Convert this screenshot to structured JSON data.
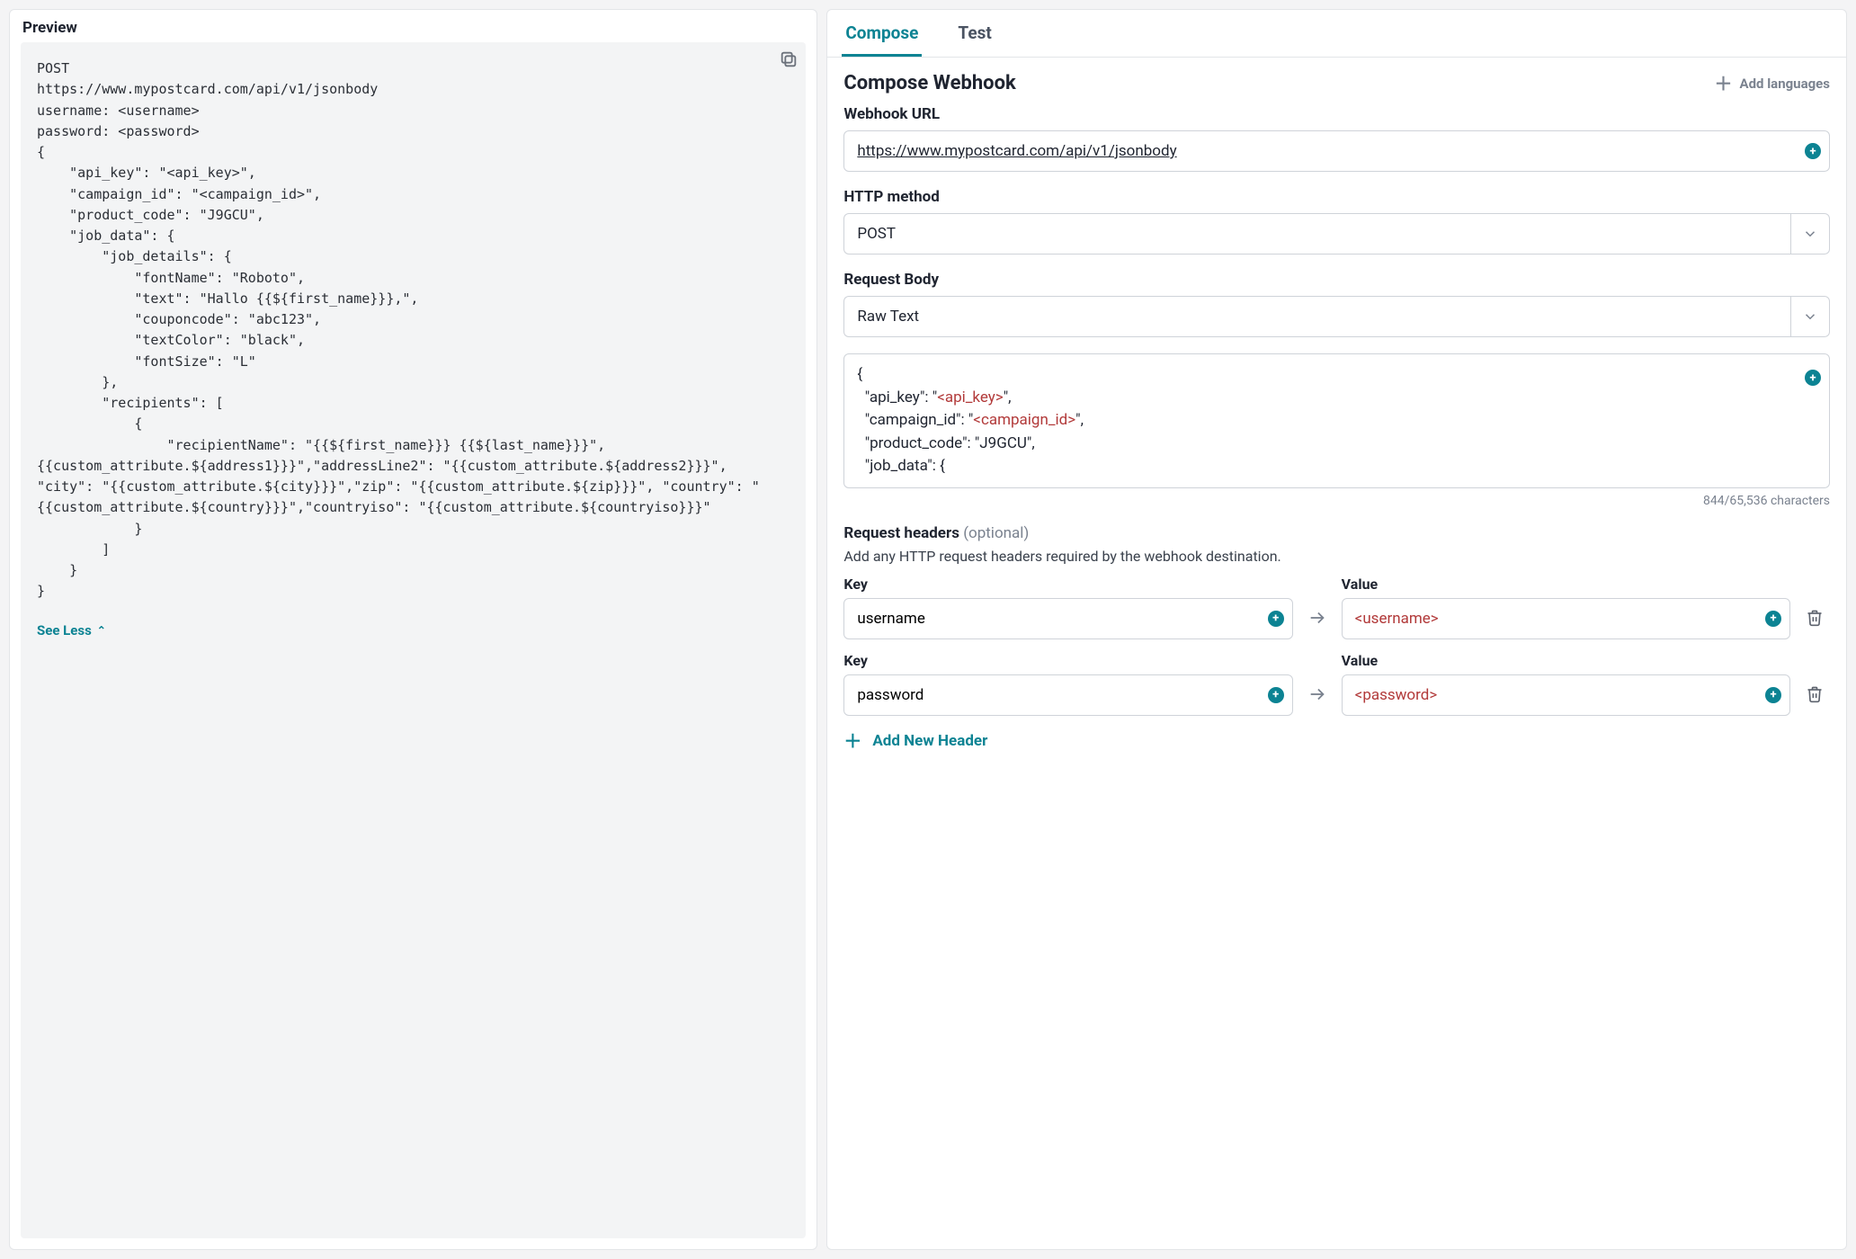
{
  "colors": {
    "accent": "#0c8393",
    "token": "#b23a3a"
  },
  "left": {
    "title": "Preview",
    "code": "POST\nhttps://www.mypostcard.com/api/v1/jsonbody\nusername: <username>\npassword: <password>\n{\n    \"api_key\": \"<api_key>\",\n    \"campaign_id\": \"<campaign_id>\",\n    \"product_code\": \"J9GCU\",\n    \"job_data\": {\n        \"job_details\": {\n            \"fontName\": \"Roboto\",\n            \"text\": \"Hallo {{${first_name}}},\",\n            \"couponcode\": \"abc123\",\n            \"textColor\": \"black\",\n            \"fontSize\": \"L\"\n        },\n        \"recipients\": [\n            {\n                \"recipientName\": \"{{${first_name}}} {{${last_name}}}\", {{custom_attribute.${address1}}}\",\"addressLine2\": \"{{custom_attribute.${address2}}}\", \"city\": \"{{custom_attribute.${city}}}\",\"zip\": \"{{custom_attribute.${zip}}}\", \"country\": \"{{custom_attribute.${country}}}\",\"countryiso\": \"{{custom_attribute.${countryiso}}}\"\n            }\n        ]\n    }\n}",
    "see_less": "See Less"
  },
  "tabs": [
    {
      "id": "compose",
      "label": "Compose",
      "active": true
    },
    {
      "id": "test",
      "label": "Test",
      "active": false
    }
  ],
  "compose": {
    "title": "Compose Webhook",
    "add_languages": "Add languages",
    "url_label": "Webhook URL",
    "url_value": "https://www.mypostcard.com/api/v1/jsonbody",
    "method_label": "HTTP method",
    "method_value": "POST",
    "body_label": "Request Body",
    "body_type": "Raw Text",
    "body_text_plain": "{\n  \"api_key\": \"<api_key>\",\n  \"campaign_id\": \"<campaign_id>\",\n  \"product_code\": \"J9GCU\",\n  \"job_data\": {",
    "body_tokens": [
      "<api_key>",
      "<campaign_id>"
    ],
    "char_count": "844/65,536 characters",
    "headers_title": "Request headers",
    "headers_optional": "(optional)",
    "headers_desc": "Add any HTTP request headers required by the webhook destination.",
    "key_label": "Key",
    "value_label": "Value",
    "headers": [
      {
        "key": "username",
        "value": "<username>"
      },
      {
        "key": "password",
        "value": "<password>"
      }
    ],
    "add_header": "Add New Header"
  }
}
